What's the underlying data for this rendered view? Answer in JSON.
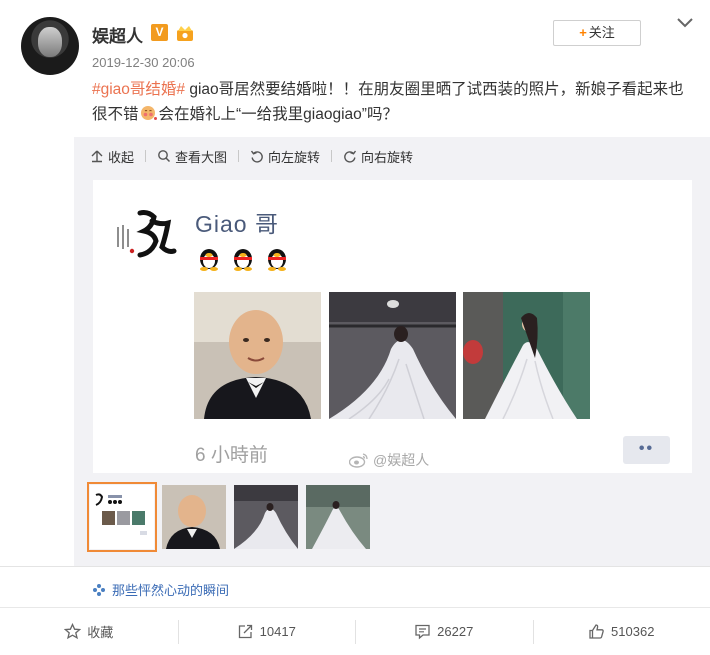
{
  "author": {
    "name": "娱超人",
    "verified_badge": "V",
    "timestamp": "2019-12-30 20:06",
    "follow_label": "关注",
    "follow_plus": "+"
  },
  "post": {
    "hashtag": "#giao哥结婚#",
    "text_before_emoji": " giao哥居然要结婚啦！！在朋友圈里晒了试西装的照片，新娘子看起来也很不错",
    "text_after_emoji": "会在婚礼上“一给我里giaogiao”吗？"
  },
  "toolbar": {
    "collapse": "收起",
    "view_large": "查看大图",
    "rotate_left": "向左旋转",
    "rotate_right": "向右旋转"
  },
  "screenshot": {
    "name": "Giao 哥",
    "time": "6 小時前",
    "more": "••",
    "watermark": "@娱超人"
  },
  "topic": {
    "label": "那些怦然心动的瞬间"
  },
  "actions": {
    "favorite": "收藏",
    "repost_count": "10417",
    "comment_count": "26227",
    "like_count": "510362"
  },
  "colors": {
    "hashtag": "#eb7350",
    "link": "#3a6bb5",
    "follow_plus": "#ff8200",
    "selected_thumb": "#f08a36"
  }
}
